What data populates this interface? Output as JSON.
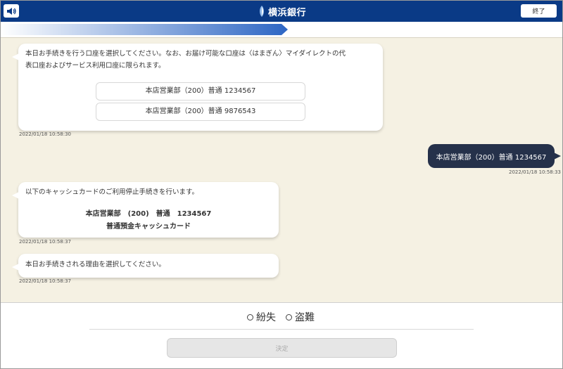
{
  "header": {
    "bank_name": "横浜銀行",
    "end_label": "終了",
    "brand_color": "#0a3a86"
  },
  "progress": {
    "fraction": 0.51
  },
  "chat": {
    "msg1": {
      "line1": "本日お手続きを行う口座を選択してください。なお、お届け可能な口座は〈はまぎん〉マイダイレクトの代",
      "line2": "表口座およびサービス利用口座に限られます。",
      "accounts": [
        "本店営業部（200）普通 1234567",
        "本店営業部（200）普通 9876543"
      ],
      "timestamp": "2022/01/18 10:58:30"
    },
    "user_reply": {
      "text": "本店営業部（200）普通 1234567",
      "timestamp": "2022/01/18 10:58:33"
    },
    "msg2": {
      "line1": "以下のキャッシュカードのご利用停止手続きを行います。",
      "confirm1": "本店営業部　(200)　普通　1234567",
      "confirm2": "普通預金キャッシュカード",
      "timestamp": "2022/01/18 10:58:37"
    },
    "msg3": {
      "line1": "本日お手続きされる理由を選択してください。",
      "timestamp": "2022/01/18 10:58:37"
    }
  },
  "options": {
    "opt1": "紛失",
    "opt2": "盗難"
  },
  "decide_label": "決定"
}
